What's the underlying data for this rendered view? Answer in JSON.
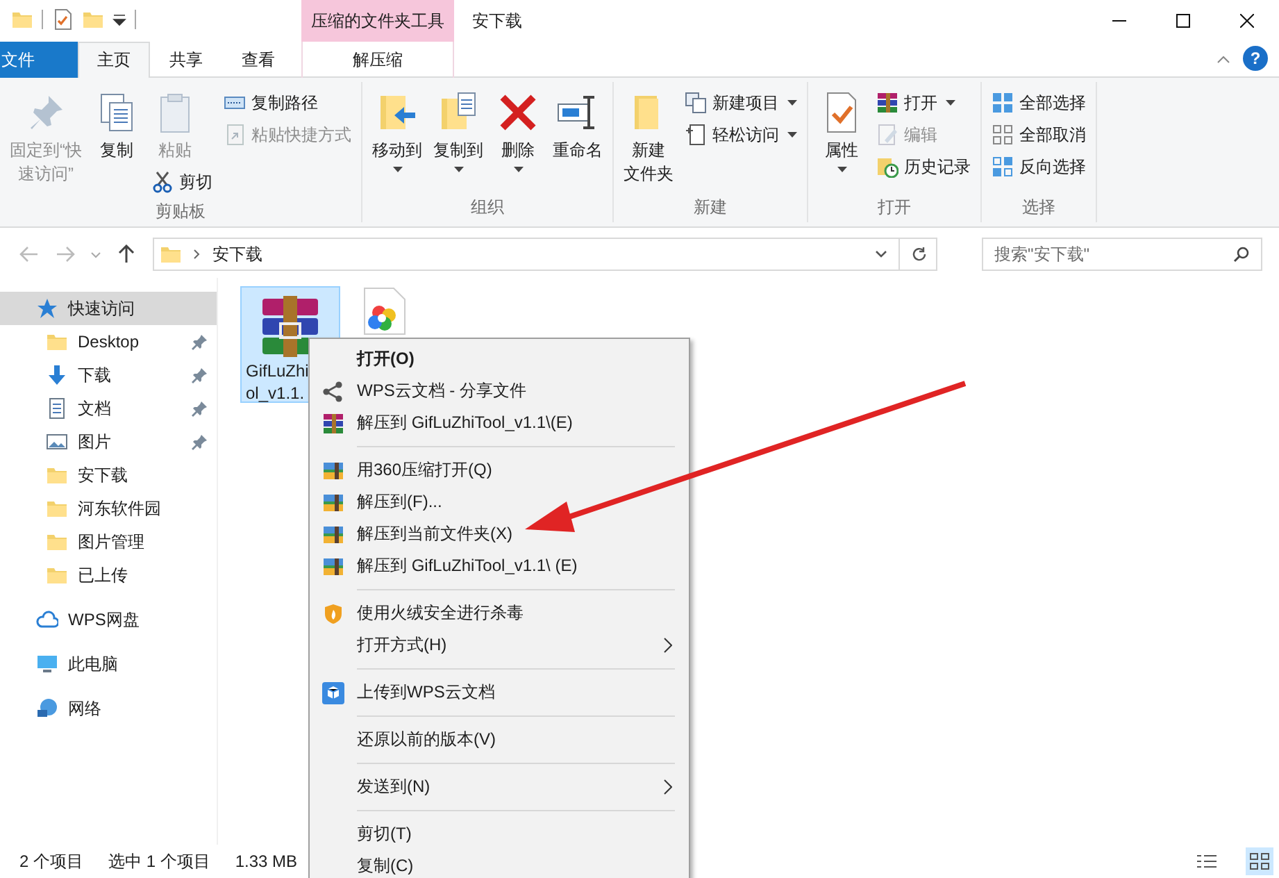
{
  "window": {
    "title": "安下载",
    "context_tab_group": "压缩的文件夹工具"
  },
  "ribbon_tabs": [
    {
      "label": "文件",
      "kind": "file",
      "selected": false
    },
    {
      "label": "主页",
      "kind": "tab",
      "selected": true
    },
    {
      "label": "共享",
      "kind": "tab",
      "selected": false
    },
    {
      "label": "查看",
      "kind": "tab",
      "selected": false
    },
    {
      "label": "解压缩",
      "kind": "context",
      "selected": false
    }
  ],
  "help_button": "?",
  "ribbon_groups": [
    {
      "label": "剪贴板",
      "columns": [
        {
          "kind": "large",
          "commands": [
            {
              "label_lines": [
                "固定到“快",
                "速访问”"
              ],
              "kind": "pin",
              "disabled": true,
              "dropdown": false
            }
          ]
        },
        {
          "kind": "large",
          "commands": [
            {
              "label": "复制",
              "kind": "copy",
              "disabled": false,
              "dropdown": false
            }
          ]
        },
        {
          "kind": "large",
          "commands": [
            {
              "label": "粘贴",
              "kind": "paste",
              "disabled": true,
              "dropdown": false
            },
            {
              "label": "剪切",
              "kind": "scissors",
              "disabled": false,
              "dropdown": false
            }
          ]
        },
        {
          "kind": "stack",
          "commands": [
            {
              "label": "复制路径",
              "kind": "copypath",
              "disabled": false,
              "dropdown": false
            },
            {
              "label": "粘贴快捷方式",
              "kind": "shortcut",
              "disabled": true,
              "dropdown": false
            }
          ]
        }
      ]
    },
    {
      "label": "组织",
      "columns": [
        {
          "kind": "large",
          "commands": [
            {
              "label": "移动到",
              "kind": "moveto",
              "disabled": false,
              "dropdown": true
            }
          ]
        },
        {
          "kind": "large",
          "commands": [
            {
              "label": "复制到",
              "kind": "copyto",
              "disabled": false,
              "dropdown": true
            }
          ]
        },
        {
          "kind": "large",
          "commands": [
            {
              "label": "删除",
              "kind": "delete",
              "disabled": false,
              "dropdown": true
            }
          ]
        },
        {
          "kind": "large",
          "commands": [
            {
              "label": "重命名",
              "kind": "rename",
              "disabled": false,
              "dropdown": false
            }
          ]
        }
      ]
    },
    {
      "label": "新建",
      "columns": [
        {
          "kind": "large",
          "commands": [
            {
              "label_lines": [
                "新建",
                "文件夹"
              ],
              "kind": "folder",
              "disabled": false,
              "dropdown": false
            }
          ]
        },
        {
          "kind": "stack",
          "commands": [
            {
              "label": "新建项目",
              "kind": "newitem",
              "disabled": false,
              "dropdown": true
            },
            {
              "label": "轻松访问",
              "kind": "easyaccess",
              "disabled": false,
              "dropdown": true
            }
          ]
        }
      ]
    },
    {
      "label": "打开",
      "columns": [
        {
          "kind": "large",
          "commands": [
            {
              "label": "属性",
              "kind": "properties",
              "disabled": false,
              "dropdown": true
            }
          ]
        },
        {
          "kind": "stack",
          "commands": [
            {
              "label": "打开",
              "kind": "archive",
              "disabled": false,
              "dropdown": true
            },
            {
              "label": "编辑",
              "kind": "edit",
              "disabled": true,
              "dropdown": false
            },
            {
              "label": "历史记录",
              "kind": "history",
              "disabled": false,
              "dropdown": false
            }
          ]
        }
      ]
    },
    {
      "label": "选择",
      "columns": [
        {
          "kind": "stack",
          "commands": [
            {
              "label": "全部选择",
              "kind": "selectall",
              "disabled": false,
              "dropdown": false
            },
            {
              "label": "全部取消",
              "kind": "selectnone",
              "disabled": false,
              "dropdown": false
            },
            {
              "label": "反向选择",
              "kind": "invert",
              "disabled": false,
              "dropdown": false
            }
          ]
        }
      ]
    }
  ],
  "address": {
    "path": [
      "安下载"
    ]
  },
  "search": {
    "placeholder": "搜索\"安下载\""
  },
  "navigation": [
    {
      "label": "快速访问",
      "kind": "star",
      "selected": true,
      "pinned": false,
      "children": [
        {
          "label": "Desktop",
          "kind": "folder",
          "selected": false,
          "pinned": true
        },
        {
          "label": "下载",
          "kind": "download",
          "selected": false,
          "pinned": true
        },
        {
          "label": "文档",
          "kind": "documents",
          "selected": false,
          "pinned": true
        },
        {
          "label": "图片",
          "kind": "pictures",
          "selected": false,
          "pinned": true
        },
        {
          "label": "安下载",
          "kind": "folder",
          "selected": false,
          "pinned": false
        },
        {
          "label": "河东软件园",
          "kind": "folder",
          "selected": false,
          "pinned": false
        },
        {
          "label": "图片管理",
          "kind": "folder",
          "selected": false,
          "pinned": false
        },
        {
          "label": "已上传",
          "kind": "folder",
          "selected": false,
          "pinned": false
        }
      ]
    },
    {
      "label": "WPS网盘",
      "kind": "cloud",
      "selected": false,
      "pinned": false
    },
    {
      "label": "此电脑",
      "kind": "pc",
      "selected": false,
      "pinned": false
    },
    {
      "label": "网络",
      "kind": "network",
      "selected": false,
      "pinned": false
    }
  ],
  "files": [
    {
      "name_lines": [
        "GifLuZhi",
        "ol_v1.1."
      ],
      "kind": "archive",
      "selected": true
    },
    {
      "kind": "image",
      "selected": false
    }
  ],
  "context_menu": [
    {
      "label": "打开(O)",
      "kind": "plain",
      "default": true,
      "submenu": false
    },
    {
      "label": "WPS云文档 - 分享文件",
      "kind": "share",
      "default": false,
      "submenu": false
    },
    {
      "label": "解压到 GifLuZhiTool_v1.1\\(E)",
      "kind": "archive",
      "default": false,
      "submenu": false
    },
    {
      "kind": "separator"
    },
    {
      "label": "用360压缩打开(Q)",
      "kind": "archive360",
      "default": false,
      "submenu": false
    },
    {
      "label": "解压到(F)...",
      "kind": "archive360",
      "default": false,
      "submenu": false
    },
    {
      "label": "解压到当前文件夹(X)",
      "kind": "archive360",
      "default": false,
      "submenu": false
    },
    {
      "label": "解压到 GifLuZhiTool_v1.1\\ (E)",
      "kind": "archive360",
      "default": false,
      "submenu": false
    },
    {
      "kind": "separator"
    },
    {
      "label": "使用火绒安全进行杀毒",
      "kind": "shield",
      "default": false,
      "submenu": false
    },
    {
      "label": "打开方式(H)",
      "kind": "plain",
      "default": false,
      "submenu": true
    },
    {
      "kind": "separator"
    },
    {
      "label": "上传到WPS云文档",
      "kind": "cube",
      "default": false,
      "submenu": false
    },
    {
      "kind": "separator"
    },
    {
      "label": "还原以前的版本(V)",
      "kind": "plain",
      "default": false,
      "submenu": false
    },
    {
      "kind": "separator"
    },
    {
      "label": "发送到(N)",
      "kind": "plain",
      "default": false,
      "submenu": true
    },
    {
      "kind": "separator"
    },
    {
      "label": "剪切(T)",
      "kind": "plain",
      "default": false,
      "submenu": false
    },
    {
      "label": "复制(C)",
      "kind": "plain",
      "default": false,
      "submenu": false
    }
  ],
  "status_bar": {
    "items": [
      "2 个项目",
      "选中 1 个项目",
      "1.33 MB"
    ]
  }
}
